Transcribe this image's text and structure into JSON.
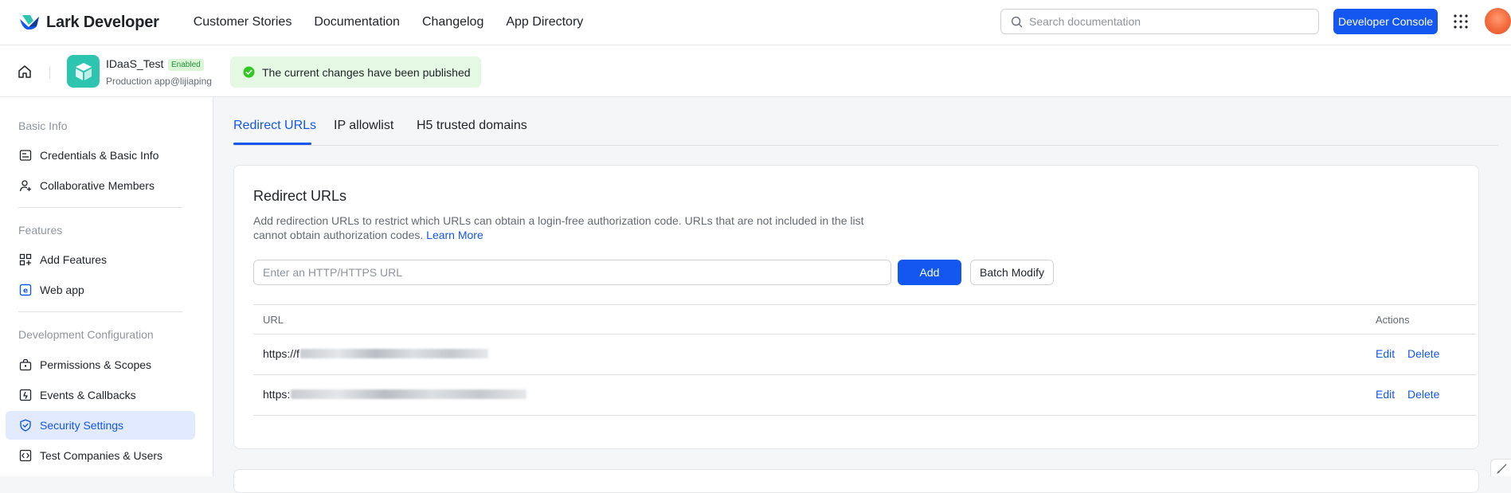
{
  "topnav": {
    "brand": "Lark Developer",
    "links": [
      "Customer Stories",
      "Documentation",
      "Changelog",
      "App Directory"
    ],
    "search_placeholder": "Search documentation",
    "console_label": "Developer Console",
    "colors": {
      "primary": "#1456f0",
      "avatar": "#f26a3c"
    }
  },
  "appbar": {
    "app_name": "IDaaS_Test",
    "status_badge": "Enabled",
    "app_sub": "Production app@lijiaping",
    "toast": "The current changes have been published",
    "app_icon_color": "#2ec5b0"
  },
  "sidebar": {
    "sections": [
      {
        "title": "Basic Info",
        "items": [
          {
            "label": "Credentials & Basic Info",
            "icon": "credentials-icon"
          },
          {
            "label": "Collaborative Members",
            "icon": "members-icon"
          }
        ]
      },
      {
        "title": "Features",
        "items": [
          {
            "label": "Add Features",
            "icon": "add-features-icon"
          },
          {
            "label": "Web app",
            "icon": "web-app-icon"
          }
        ]
      },
      {
        "title": "Development Configuration",
        "items": [
          {
            "label": "Permissions & Scopes",
            "icon": "permissions-icon"
          },
          {
            "label": "Events & Callbacks",
            "icon": "events-icon"
          },
          {
            "label": "Security Settings",
            "icon": "shield-icon",
            "active": true
          },
          {
            "label": "Test Companies & Users",
            "icon": "code-icon"
          }
        ]
      }
    ]
  },
  "tabs": [
    {
      "label": "Redirect URLs",
      "active": true
    },
    {
      "label": "IP allowlist"
    },
    {
      "label": "H5 trusted domains"
    }
  ],
  "card": {
    "title": "Redirect URLs",
    "desc": "Add redirection URLs to restrict which URLs can obtain a login-free authorization code. URLs that are not included in the list cannot obtain authorization codes.",
    "learn_more": "Learn More",
    "input_placeholder": "Enter an HTTP/HTTPS URL",
    "add_label": "Add",
    "batch_label": "Batch Modify",
    "table": {
      "columns": [
        "URL",
        "Actions"
      ],
      "rows": [
        {
          "url_prefix": "https://f",
          "edit": "Edit",
          "delete": "Delete"
        },
        {
          "url_prefix": "https:",
          "edit": "Edit",
          "delete": "Delete"
        }
      ]
    }
  }
}
